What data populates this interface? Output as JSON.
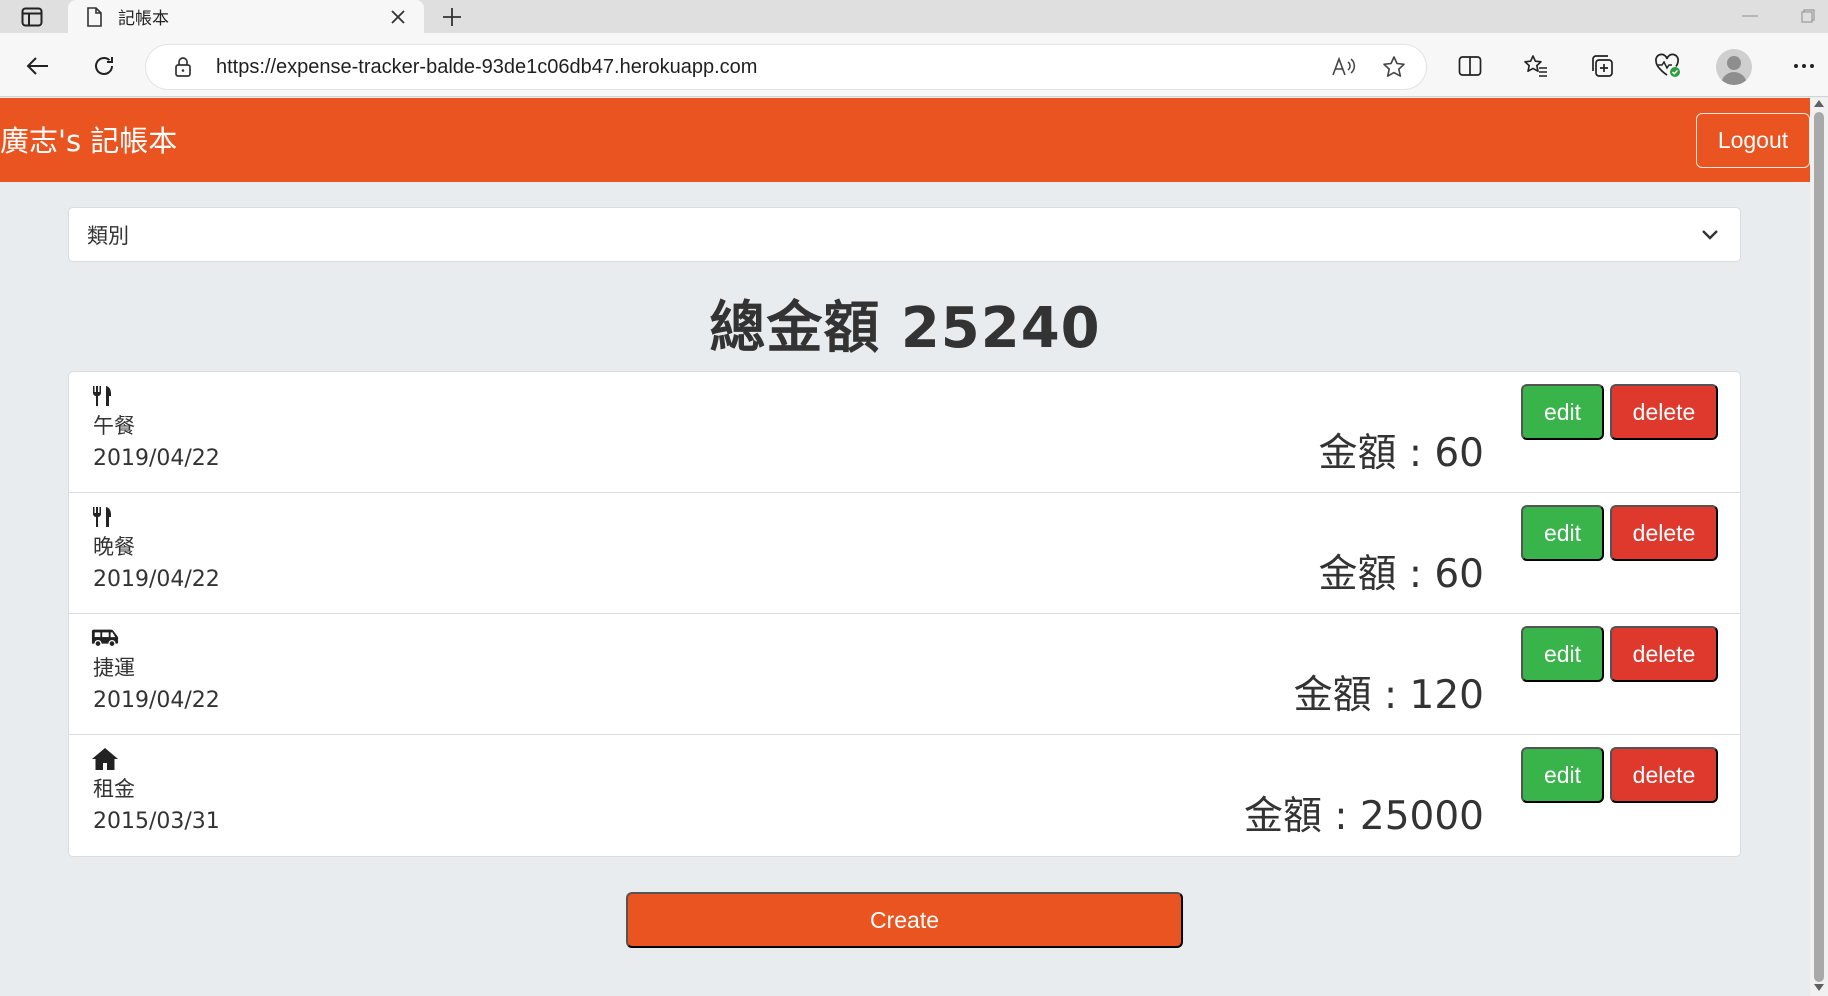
{
  "browser": {
    "tab_title": "記帳本",
    "url": "https://expense-tracker-balde-93de1c06db47.herokuapp.com"
  },
  "navbar": {
    "brand": "廣志's 記帳本",
    "logout_label": "Logout"
  },
  "filter": {
    "category_label": "類別"
  },
  "summary": {
    "total_text": "總金額 25240"
  },
  "records": [
    {
      "icon": "utensils-icon",
      "name": "午餐",
      "date": "2019/04/22",
      "amount_text": "金額 : 60",
      "edit_label": "edit",
      "delete_label": "delete"
    },
    {
      "icon": "utensils-icon",
      "name": "晚餐",
      "date": "2019/04/22",
      "amount_text": "金額 : 60",
      "edit_label": "edit",
      "delete_label": "delete"
    },
    {
      "icon": "shuttle-van-icon",
      "name": "捷運",
      "date": "2019/04/22",
      "amount_text": "金額 : 120",
      "edit_label": "edit",
      "delete_label": "delete"
    },
    {
      "icon": "home-icon",
      "name": "租金",
      "date": "2015/03/31",
      "amount_text": "金額 : 25000",
      "edit_label": "edit",
      "delete_label": "delete"
    }
  ],
  "actions": {
    "create_label": "Create"
  },
  "colors": {
    "primary": "#e95420",
    "success": "#38b44a",
    "danger": "#df382c",
    "background": "#e9ecef"
  }
}
